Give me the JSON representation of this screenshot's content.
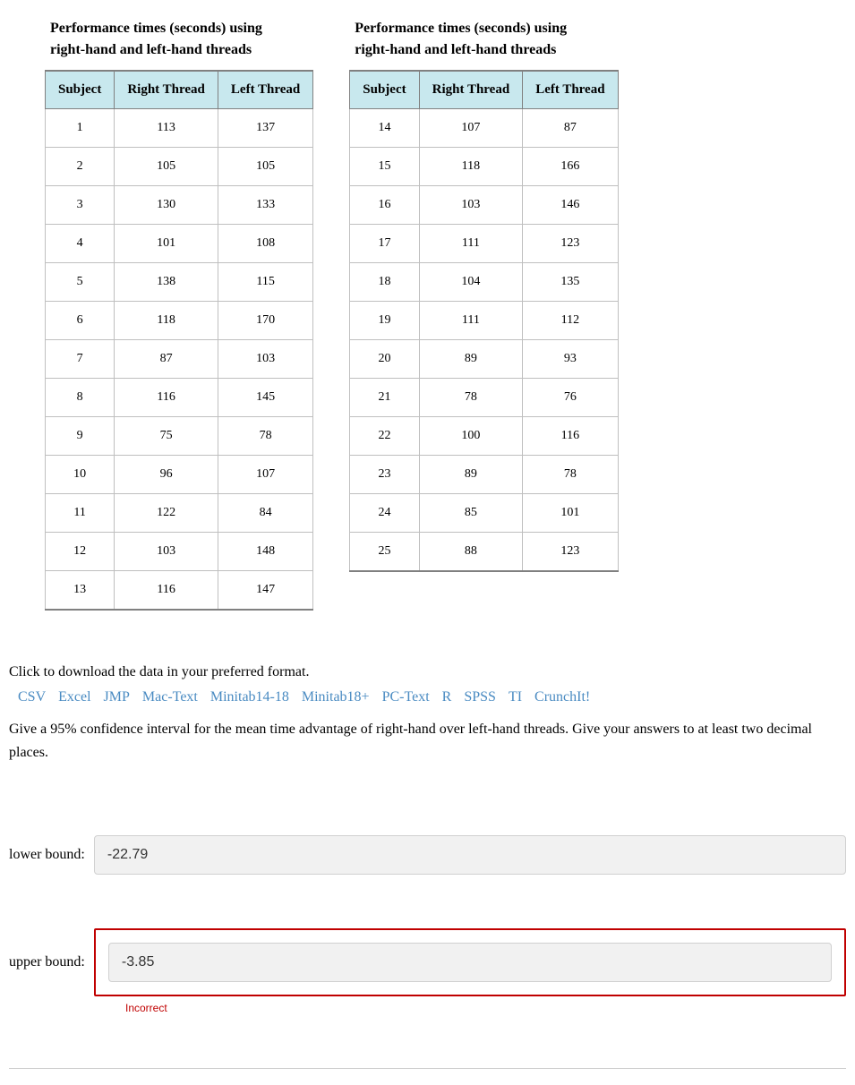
{
  "table1": {
    "title_line1": "Performance times (seconds) using",
    "title_line2": "right-hand and left-hand threads",
    "headers": [
      "Subject",
      "Right Thread",
      "Left Thread"
    ],
    "rows": [
      [
        "1",
        "113",
        "137"
      ],
      [
        "2",
        "105",
        "105"
      ],
      [
        "3",
        "130",
        "133"
      ],
      [
        "4",
        "101",
        "108"
      ],
      [
        "5",
        "138",
        "115"
      ],
      [
        "6",
        "118",
        "170"
      ],
      [
        "7",
        "87",
        "103"
      ],
      [
        "8",
        "116",
        "145"
      ],
      [
        "9",
        "75",
        "78"
      ],
      [
        "10",
        "96",
        "107"
      ],
      [
        "11",
        "122",
        "84"
      ],
      [
        "12",
        "103",
        "148"
      ],
      [
        "13",
        "116",
        "147"
      ]
    ]
  },
  "table2": {
    "title_line1": "Performance times (seconds) using",
    "title_line2": "right-hand and left-hand threads",
    "headers": [
      "Subject",
      "Right Thread",
      "Left Thread"
    ],
    "rows": [
      [
        "14",
        "107",
        "87"
      ],
      [
        "15",
        "118",
        "166"
      ],
      [
        "16",
        "103",
        "146"
      ],
      [
        "17",
        "111",
        "123"
      ],
      [
        "18",
        "104",
        "135"
      ],
      [
        "19",
        "111",
        "112"
      ],
      [
        "20",
        "89",
        "93"
      ],
      [
        "21",
        "78",
        "76"
      ],
      [
        "22",
        "100",
        "116"
      ],
      [
        "23",
        "89",
        "78"
      ],
      [
        "24",
        "85",
        "101"
      ],
      [
        "25",
        "88",
        "123"
      ]
    ]
  },
  "download": {
    "prompt": "Click to download the data in your preferred format.",
    "links": [
      "CSV",
      "Excel",
      "JMP",
      "Mac-Text",
      "Minitab14-18",
      "Minitab18+",
      "PC-Text",
      "R",
      "SPSS",
      "TI",
      "CrunchIt!"
    ]
  },
  "question": "Give a 95% confidence interval for the mean time advantage of right-hand over left-hand threads. Give your answers to at least two decimal places.",
  "answers": {
    "lower_label": "lower bound:",
    "lower_value": "-22.79",
    "upper_label": "upper bound:",
    "upper_value": "-3.85",
    "incorrect_text": "Incorrect"
  }
}
